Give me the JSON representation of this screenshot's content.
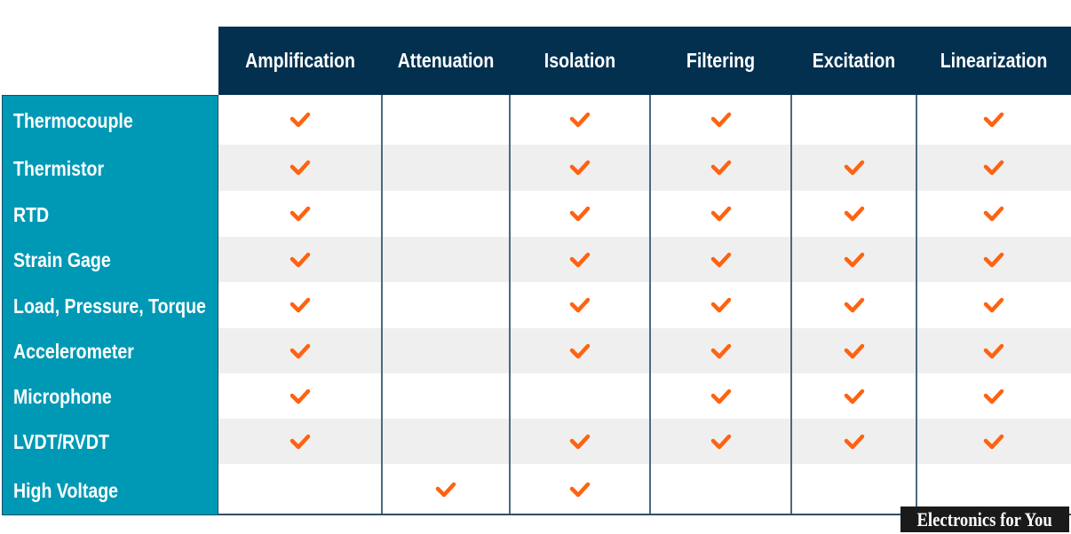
{
  "chart_data": {
    "type": "table",
    "title": "",
    "columns": [
      "Amplification",
      "Attenuation",
      "Isolation",
      "Filtering",
      "Excitation",
      "Linearization"
    ],
    "rows": [
      {
        "label": "Thermocouple",
        "values": [
          true,
          false,
          true,
          true,
          false,
          true
        ]
      },
      {
        "label": "Thermistor",
        "values": [
          true,
          false,
          true,
          true,
          true,
          true
        ]
      },
      {
        "label": "RTD",
        "values": [
          true,
          false,
          true,
          true,
          true,
          true
        ]
      },
      {
        "label": "Strain Gage",
        "values": [
          true,
          false,
          true,
          true,
          true,
          true
        ]
      },
      {
        "label": "Load, Pressure, Torque",
        "values": [
          true,
          false,
          true,
          true,
          true,
          true
        ]
      },
      {
        "label": "Accelerometer",
        "values": [
          true,
          false,
          true,
          true,
          true,
          true
        ]
      },
      {
        "label": "Microphone",
        "values": [
          true,
          false,
          false,
          true,
          true,
          true
        ]
      },
      {
        "label": "LVDT/RVDT",
        "values": [
          true,
          false,
          true,
          true,
          true,
          true
        ]
      },
      {
        "label": "High Voltage",
        "values": [
          false,
          true,
          true,
          false,
          false,
          false
        ]
      }
    ],
    "mark_icon": "checkmark-icon"
  },
  "colors": {
    "header_bg": "#03304f",
    "row_label_bg": "#0099b5",
    "check": "#ff6210",
    "stripe": "#efefef"
  },
  "watermark": "Electronics for You"
}
